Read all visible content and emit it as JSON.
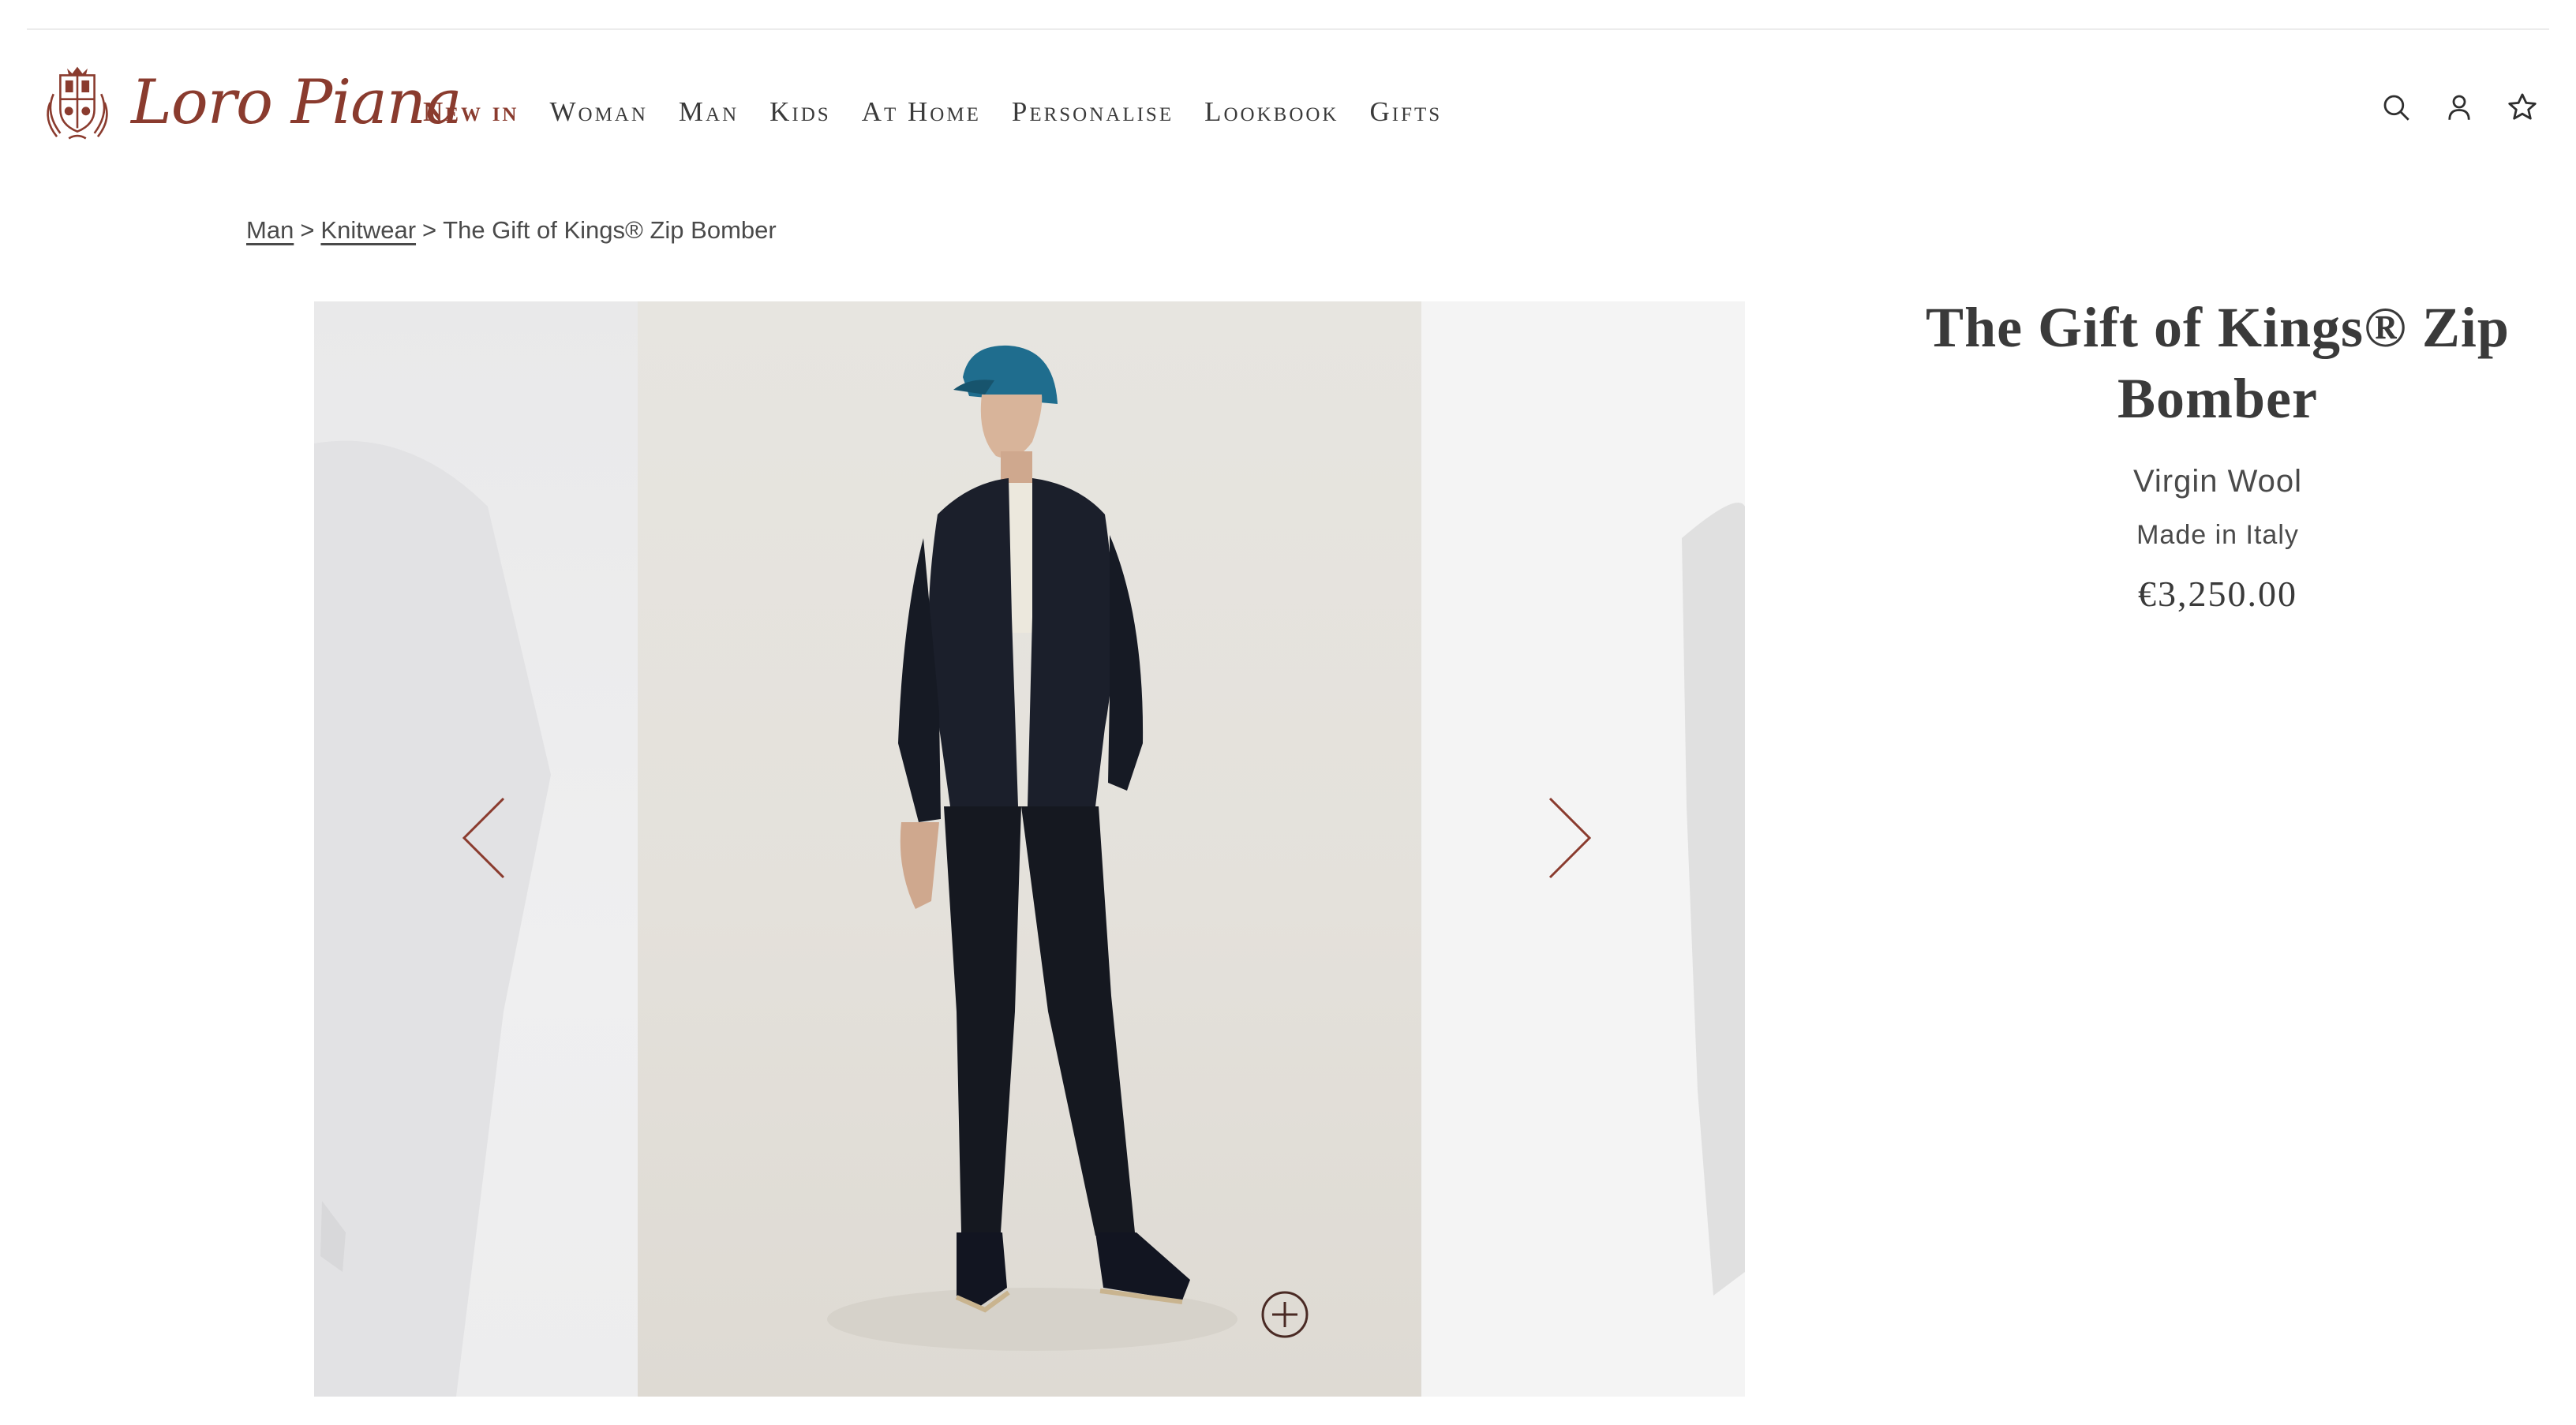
{
  "brand": {
    "logo_text": "Loro Piana",
    "color": "#8a3b2e"
  },
  "nav": {
    "items": [
      {
        "label": "New in",
        "highlight": true
      },
      {
        "label": "Woman"
      },
      {
        "label": "Man"
      },
      {
        "label": "Kids"
      },
      {
        "label": "At Home"
      },
      {
        "label": "Personalise"
      },
      {
        "label": "Lookbook"
      },
      {
        "label": "Gifts"
      }
    ]
  },
  "header_icons": [
    "search-icon",
    "account-icon",
    "wishlist-star-icon"
  ],
  "breadcrumb": {
    "items": [
      "Man",
      "Knitwear"
    ],
    "current": "The Gift of Kings® Zip Bomber",
    "separator": ">"
  },
  "gallery": {
    "prev_icon": "chevron-left-icon",
    "next_icon": "chevron-right-icon",
    "zoom_icon": "plus-circle-icon"
  },
  "product": {
    "title": "The Gift of Kings® Zip Bomber",
    "material": "Virgin Wool",
    "origin": "Made in Italy",
    "price": "€3,250.00"
  }
}
